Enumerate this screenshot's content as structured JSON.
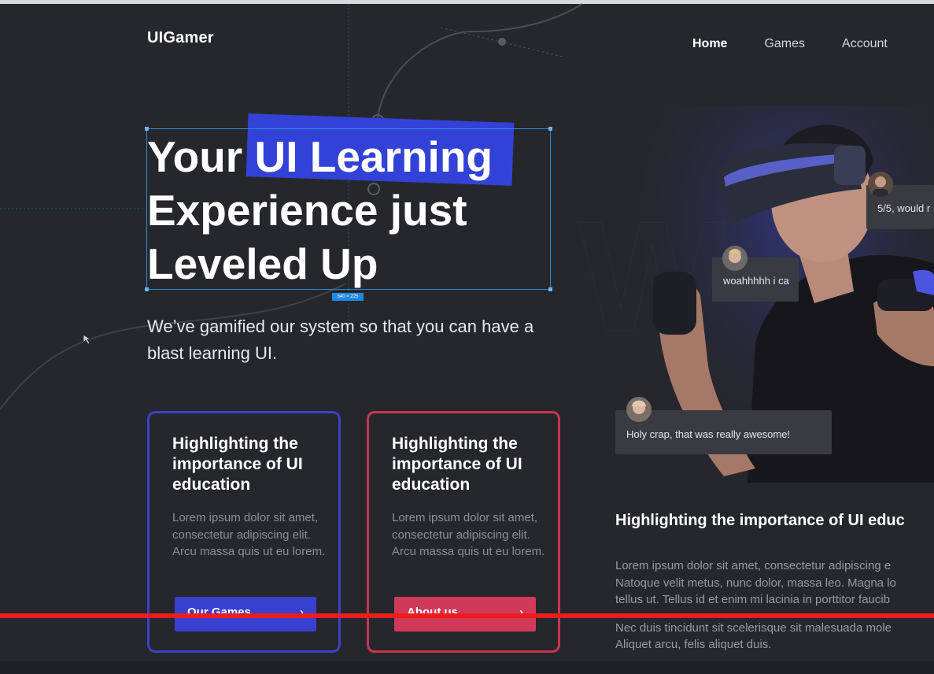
{
  "brand": {
    "logo": "UIGamer"
  },
  "nav": {
    "items": [
      "Home",
      "Games",
      "Account"
    ],
    "active": "Home"
  },
  "hero": {
    "headline_pre": "Your ",
    "headline_highlight": "UI Learning",
    "headline_line2": "Experience just",
    "headline_line3": "Leveled Up",
    "subtitle": "We’ve gamified our system so that you can have a blast learning UI.",
    "selection_size_label": "540 × 225"
  },
  "cards": [
    {
      "title": "Highlighting the importance of UI education",
      "body": "Lorem ipsum dolor sit amet, consectetur adipiscing elit. Arcu massa quis ut eu lorem.",
      "button": "Our Games",
      "accent": "#3a42c9"
    },
    {
      "title": "Highlighting the importance of UI education",
      "body": "Lorem ipsum dolor sit amet, consectetur adipiscing elit. Arcu massa quis ut eu lorem.",
      "button": "About us",
      "accent": "#c8354f"
    }
  ],
  "comments": [
    {
      "text": "5/5, would r"
    },
    {
      "text": "woahhhhh i ca"
    },
    {
      "text": "Holy crap, that was really awesome!"
    }
  ],
  "section": {
    "title": "Highlighting the importance of UI educ",
    "paragraph1": [
      "Lorem ipsum dolor sit amet, consectetur adipiscing e",
      "Natoque velit metus, nunc dolor, massa leo. Magna lo",
      "tellus ut. Tellus id et enim mi lacinia in porttitor faucib"
    ],
    "paragraph2": [
      "Nec duis tincidunt sit scelerisque sit malesuada mole",
      "Aliquet arcu, felis aliquet duis."
    ]
  },
  "colors": {
    "background": "#26272d",
    "primary": "#3840cf",
    "secondary": "#d03a5a",
    "highlight": "#3342d6"
  },
  "icons": [
    "arrow-right-icon",
    "cursor-icon"
  ]
}
